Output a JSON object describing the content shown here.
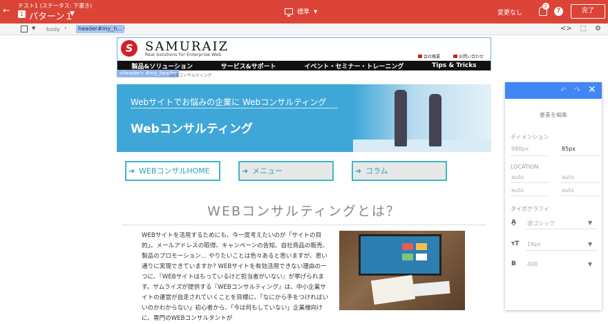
{
  "topbar": {
    "back_icon": "back-arrow-icon",
    "subtitle": "テスト1 (ステータス: 下書き)",
    "pattern_number": "1",
    "title": "パターン１",
    "device_label": "標準",
    "status_text": "変更なし",
    "notification_count": "2",
    "done_label": "完了",
    "accent": "#db4437"
  },
  "breadcrumb": {
    "body": "body",
    "header": "header#my_h..."
  },
  "site": {
    "logo_mark": "S",
    "logo_text": "SAMURAIZ",
    "logo_tagline": "Real Solutions for Enterprise Web",
    "header_links": [
      "会社概要",
      "お問い合わせ"
    ],
    "nav": [
      "製品&ソリューション",
      "サービス&サポート",
      "イベント・セミナー・トレーニング",
      "Tips & Tricks"
    ],
    "selected_tag": "<header> #my_header",
    "crumb": "WEBコンサルティング"
  },
  "hero": {
    "small": "Webサイトでお悩みの企業に Webコンサルティング",
    "big": "Webコンサルティング",
    "color": "#3fa7d8"
  },
  "buttons": [
    "WEBコンサルHOME",
    "メニュー",
    "コラム"
  ],
  "section": {
    "title": "WEBコンサルティングとは？",
    "body": "WEBサイトを活用するためにも、今一度考えたいのが「サイトの目的」。メールアドレスの取得、キャンペーンの告知、自社商品の販売、製品のプロモーション… やりたいことは色々あると思いますが、思い通りに実現できていますか? WEBサイトを有効活用できない理由の一つに、『WEBサイトはもっているけど担当者がいない』が挙げられます。サムライズが提供する『WEBコンサルティング』は、中小企業サイトの運営が自走されていくことを目標に、「なにから手をつければいいのかわからない」初心者から、「今は何もしていない」企業様向けに、専門のWEBコンサルタントが"
  },
  "panel": {
    "edit_label": "要素を編集",
    "dimension_label": "ディメンション",
    "width_placeholder": "980px",
    "height_value": "85px",
    "location_label": "LOCATION",
    "loc_values": [
      "auto",
      "auto",
      "auto",
      "auto"
    ],
    "typography_label": "タイポグラフィ",
    "font_family": "游ゴシック",
    "font_size": "16px",
    "font_weight": "400",
    "header_color": "#4285f4"
  }
}
